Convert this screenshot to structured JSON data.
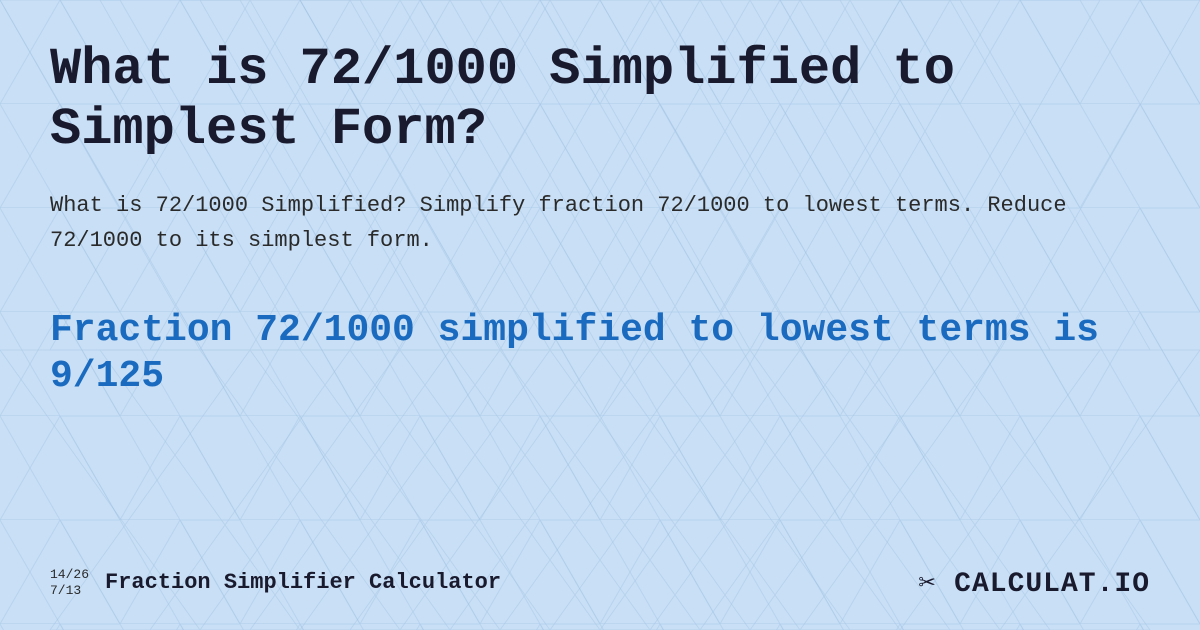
{
  "page": {
    "title": "What is 72/1000 Simplified to Simplest Form?",
    "description": "What is 72/1000 Simplified? Simplify fraction 72/1000 to lowest terms. Reduce 72/1000 to its simplest form.",
    "result": "Fraction 72/1000 simplified to lowest terms is 9/125",
    "footer": {
      "fraction1": "14/26",
      "fraction2": "7/13",
      "label": "Fraction Simplifier Calculator",
      "logo": "✂ CALCULAT.IO"
    }
  },
  "colors": {
    "background": "#c8dff5",
    "title": "#1a1a2e",
    "description": "#2a2a2a",
    "result": "#1a6bbf"
  }
}
